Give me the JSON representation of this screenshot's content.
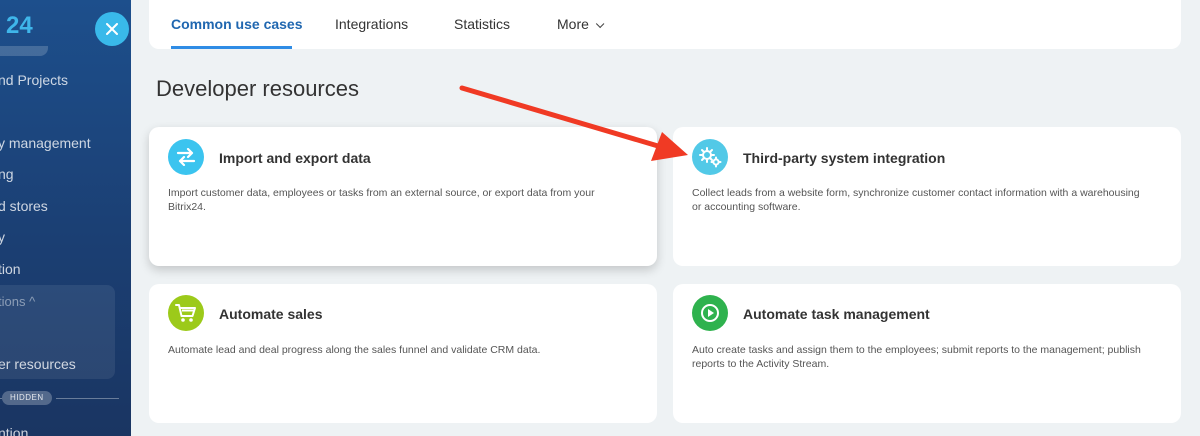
{
  "sidebar": {
    "logo_text": "24",
    "close_icon": "close-icon",
    "items": [
      {
        "label": "nd Projects"
      },
      {
        "label": "y management"
      },
      {
        "label": "ng"
      },
      {
        "label": "d stores"
      },
      {
        "label": "y"
      },
      {
        "label": "tion"
      },
      {
        "label": "tions ^"
      },
      {
        "label": "er resources"
      },
      {
        "label": "ntion"
      }
    ],
    "hidden_badge": "HIDDEN"
  },
  "tabs": [
    {
      "label": "Common use cases",
      "active": true
    },
    {
      "label": "Integrations"
    },
    {
      "label": "Statistics"
    },
    {
      "label": "More"
    }
  ],
  "section_title": "Developer resources",
  "cards": [
    {
      "title": "Import and export data",
      "description": "Import customer data, employees or tasks from an external source, or export data from your Bitrix24.",
      "icon": "swap-arrows-icon",
      "color": "#3bc4ef"
    },
    {
      "title": "Third-party system integration",
      "description": "Collect leads from a website form, synchronize customer contact information with a warehousing or accounting software.",
      "icon": "gears-icon",
      "color": "#52c9e7"
    },
    {
      "title": "Automate sales",
      "description": "Automate lead and deal progress along the sales funnel and validate CRM data.",
      "icon": "cart-icon",
      "color": "#9cca1a"
    },
    {
      "title": "Automate task management",
      "description": "Auto create tasks and assign them to the employees; submit reports to the management; publish reports to the Activity Stream.",
      "icon": "play-icon",
      "color": "#2fb24e"
    }
  ],
  "colors": {
    "accent": "#2067b0",
    "annotation_arrow": "#f03a24"
  }
}
